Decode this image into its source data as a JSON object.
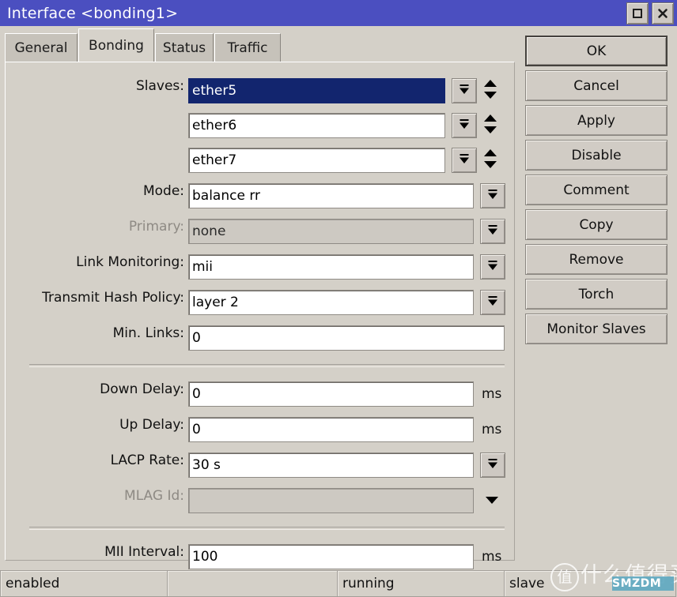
{
  "window": {
    "title": "Interface <bonding1>",
    "titlebar_color": "#4b4fc0",
    "buttons": [
      {
        "name": "maximize-button",
        "icon": "maximize-icon"
      },
      {
        "name": "close-button",
        "icon": "close-icon"
      }
    ]
  },
  "tabs": [
    {
      "label": "General",
      "active": false
    },
    {
      "label": "Bonding",
      "active": true
    },
    {
      "label": "Status",
      "active": false
    },
    {
      "label": "Traffic",
      "active": false
    }
  ],
  "form": {
    "slaves": {
      "label": "Slaves:",
      "values": [
        "ether5",
        "ether6",
        "ether7"
      ],
      "selected_index": 0
    },
    "mode": {
      "label": "Mode:",
      "value": "balance rr"
    },
    "primary": {
      "label": "Primary:",
      "value": "none",
      "disabled": true
    },
    "link_monitoring": {
      "label": "Link Monitoring:",
      "value": "mii"
    },
    "transmit_hash_policy": {
      "label": "Transmit Hash Policy:",
      "value": "layer 2"
    },
    "min_links": {
      "label": "Min. Links:",
      "value": "0"
    },
    "down_delay": {
      "label": "Down Delay:",
      "value": "0",
      "unit": "ms"
    },
    "up_delay": {
      "label": "Up Delay:",
      "value": "0",
      "unit": "ms"
    },
    "lacp_rate": {
      "label": "LACP Rate:",
      "value": "30 s"
    },
    "mlag_id": {
      "label": "MLAG Id:",
      "value": "",
      "disabled": true
    },
    "mii_interval": {
      "label": "MII Interval:",
      "value": "100",
      "unit": "ms"
    }
  },
  "actions": [
    {
      "label": "OK",
      "name": "ok-button",
      "default": true
    },
    {
      "label": "Cancel",
      "name": "cancel-button",
      "default": false
    },
    {
      "label": "Apply",
      "name": "apply-button",
      "default": false
    },
    {
      "label": "Disable",
      "name": "disable-button",
      "default": false
    },
    {
      "label": "Comment",
      "name": "comment-button",
      "default": false
    },
    {
      "label": "Copy",
      "name": "copy-button",
      "default": false
    },
    {
      "label": "Remove",
      "name": "remove-button",
      "default": false
    },
    {
      "label": "Torch",
      "name": "torch-button",
      "default": false
    },
    {
      "label": "Monitor Slaves",
      "name": "monitor-slaves-button",
      "default": false
    }
  ],
  "statusbar": [
    {
      "text": "enabled"
    },
    {
      "text": ""
    },
    {
      "text": "running"
    },
    {
      "text": "slave"
    }
  ],
  "watermark": {
    "logo_char": "值",
    "text": "什么值得买",
    "badge": "SMZDM",
    "badge_color": "#5fa8c0"
  }
}
